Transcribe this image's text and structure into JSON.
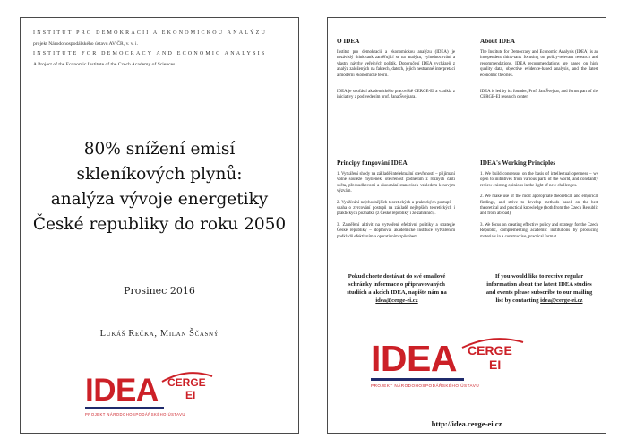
{
  "left": {
    "header": {
      "line1": "Institut pro demokracii a ekonomickou analýzu",
      "line2": "projekt Národohospodářského ústavu AV ČR, v. v. i.",
      "line3": "Institute for Democracy and Economic Analysis",
      "line4": "A Project of the Economic Institute of the Czech Academy of Sciences"
    },
    "title_lines": [
      "80% snížení emisí",
      "skleníkových plynů:",
      "analýza vývoje energetiky",
      "České republiky do roku 2050"
    ],
    "date": "Prosinec 2016",
    "authors": "Lukáš Rečka, Milan Ščasný",
    "logo": {
      "idea": "IDEA",
      "cerge": "CERGE",
      "ei": "EI",
      "subtitle": "Projekt Národohospodářského ústavu"
    }
  },
  "right": {
    "cz": {
      "about_heading": "O IDEA",
      "about_p1": "Institut pro demokracii a ekonomickou analýzu (IDEA) je nezávislý think-tank zaměřující se na analýzu, vyhodnocování a vlastní návrhy veřejných politik. Doporučení IDEA vycházejí z analýz založených na faktech, datech, jejich nestranné interpretaci a moderní ekonomické teorii.",
      "about_p2": "IDEA je součástí akademického pracoviště CERGE-EI a vznikla z iniciativy a pod vedením prof. Jana Švejnara.",
      "principles_heading": "Principy fungování IDEA",
      "principles": [
        "1. Vytváření shody na základě intelektuální otevřenosti – přijímání volné soutěže myšlenek, otevřenost podnětům z různých částí světa, předsudkovosti a zkoumání stanovisek vzhledem k novým výzvám.",
        "2. Využívání nejvhodnějších teoretických a praktických postupů – snaha o zvrcování postupů na základě nejlepších teoretických i praktických poznatků (z České republiky i ze zahraničí).",
        "3. Zaměření aktivit na vytvoření efektivní politiky a strategie České republiky – doplňovat akademické instituce vytvářením podkladů efektivním a operativním způsobem."
      ],
      "cta_text": "Pokud chcete dostávat do své emailové schránky informace o připravovaných studiích a akcích IDEA, napište nám na",
      "cta_email": "idea@cerge-ei.cz"
    },
    "en": {
      "about_heading": "About IDEA",
      "about_p1": "The Institute for Democracy and Economic Analysis (IDEA) is an independent think-tank focusing on policy-relevant research and recommendations. IDEA recommendations are based on high quality data, objective evidence-based analysis, and the latest economic theories.",
      "about_p2": "IDEA is led by its founder, Prof. Jan Švejnar, and forms part of the CERGE-EI research center.",
      "principles_heading": "IDEA's Working Principles",
      "principles": [
        "1. We build consensus on the basis of intellectual openness – we open to initiatives from various parts of the world, and constantly review existing opinions in the light of new challenges.",
        "2. We make use of the most appropriate theoretical and empirical findings, and strive to develop methods based on the best theoretical and practical knowledge (both from the Czech Republic and from abroad).",
        "3. We focus on creating effective policy and strategy for the Czech Republic, complementing academic institutions by producing materials in a constructive, practical format."
      ],
      "cta_text": "If you would like to receive regular information about the latest IDEA studies and events please subscribe to our mailing list by contacting",
      "cta_email": "idea@cerge-ei.cz"
    },
    "logo": {
      "idea": "IDEA",
      "cerge": "CERGE",
      "ei": "EI",
      "subtitle": "Projekt Národohospodářského ústavu"
    },
    "url": "http://idea.cerge-ei.cz"
  },
  "colors": {
    "brand_red": "#cc2027",
    "brand_navy": "#1f2a6b",
    "border": "#4a4a4a"
  }
}
